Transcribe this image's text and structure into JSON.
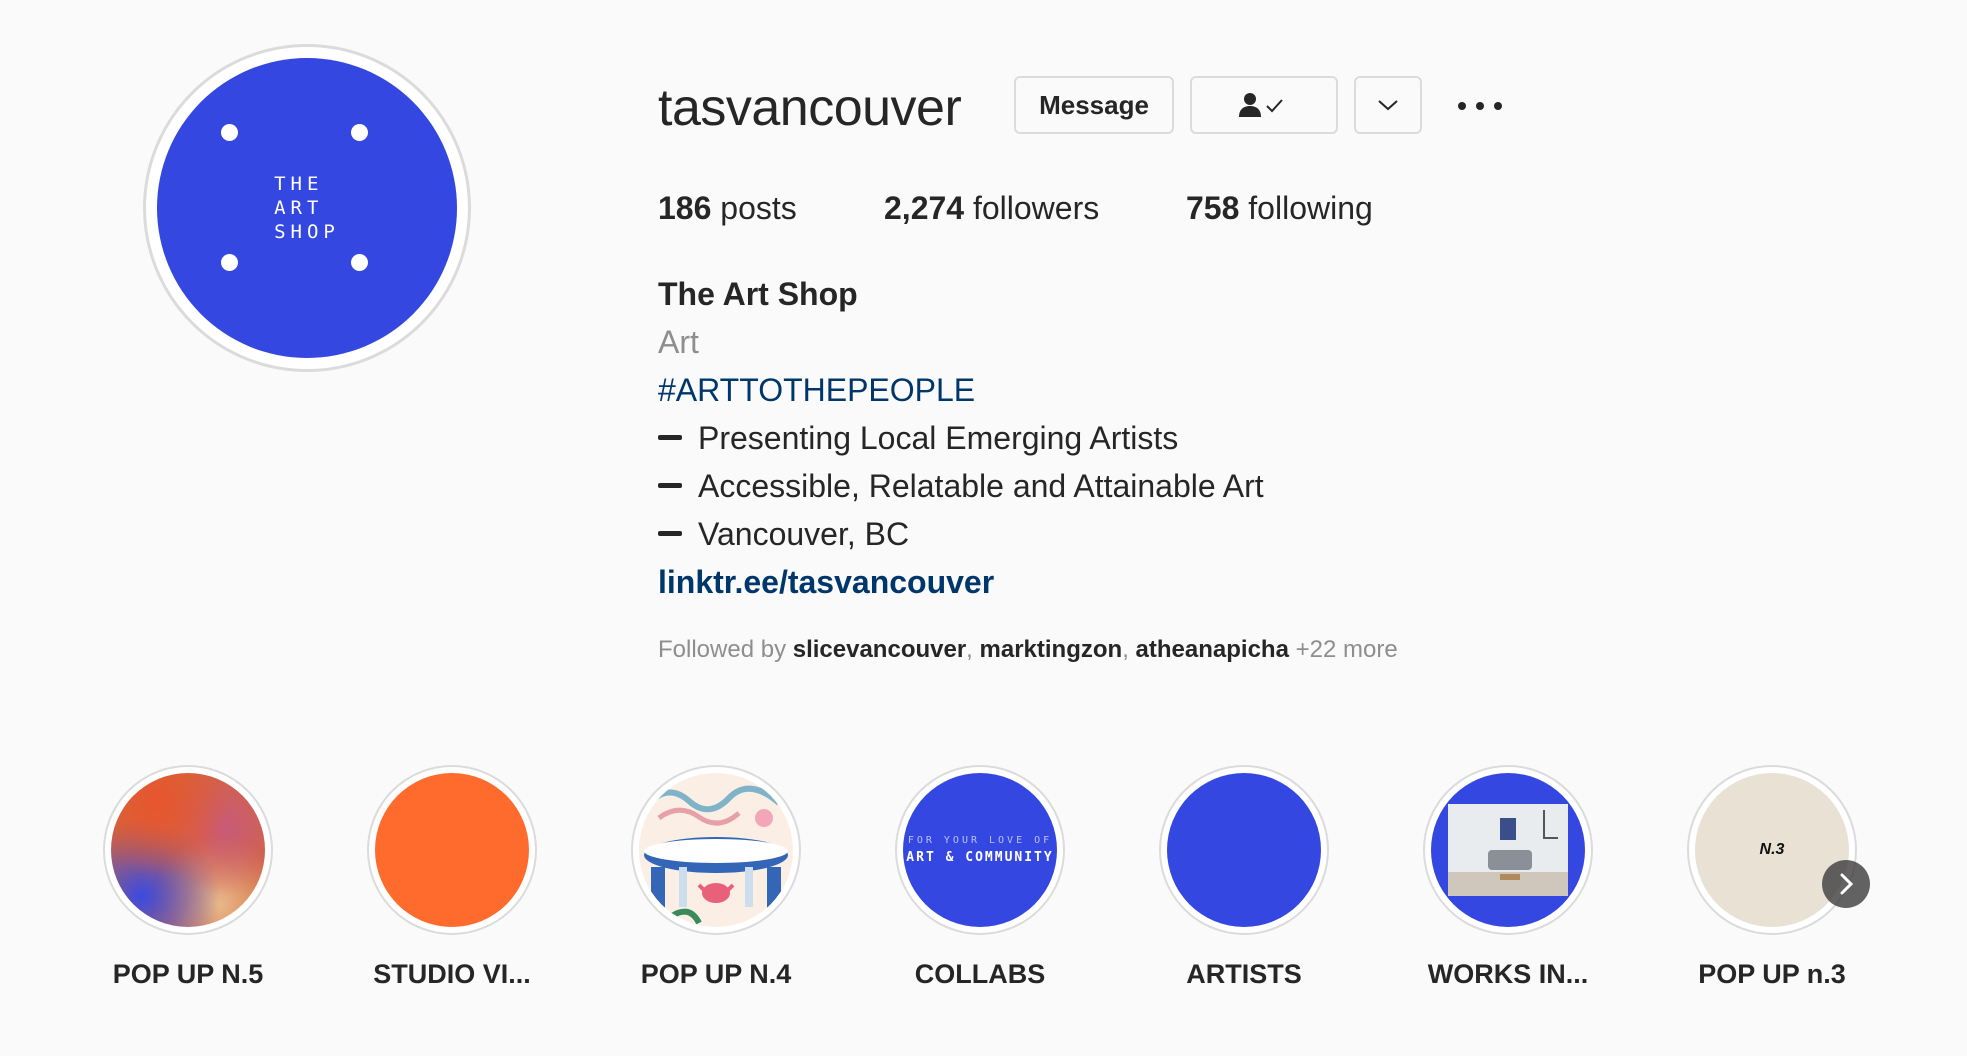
{
  "profile": {
    "username": "tasvancouver",
    "avatar_text": [
      "THE",
      "ART",
      "SHOP"
    ],
    "avatar_color": "#3447e1"
  },
  "actions": {
    "message_label": "Message",
    "following_icon": "person-check-icon",
    "dropdown_icon": "chevron-down-icon",
    "more_icon": "more-options-icon"
  },
  "stats": {
    "posts_count": "186",
    "posts_label": "posts",
    "followers_count": "2,274",
    "followers_label": "followers",
    "following_count": "758",
    "following_label": "following"
  },
  "bio": {
    "name": "The Art Shop",
    "category": "Art",
    "hashtag": "#ARTTOTHEPEOPLE",
    "lines": [
      "Presenting Local Emerging Artists",
      "Accessible, Relatable and Attainable Art",
      "Vancouver, BC"
    ],
    "link": "linktr.ee/tasvancouver"
  },
  "followed_by": {
    "prefix": "Followed by",
    "users": [
      "slicevancouver",
      "marktingzon",
      "atheanapicha"
    ],
    "more": "+22 more"
  },
  "highlights": [
    {
      "label": "POP UP N.5"
    },
    {
      "label": "STUDIO VI..."
    },
    {
      "label": "POP UP N.4"
    },
    {
      "label": "COLLABS",
      "caption_top": "FOR YOUR LOVE OF",
      "caption_bottom": "ART & COMMUNITY"
    },
    {
      "label": "ARTISTS"
    },
    {
      "label": "WORKS IN..."
    },
    {
      "label": "POP UP n.3",
      "caption": "N.3"
    }
  ],
  "colors": {
    "brand_blue": "#3447e1",
    "orange": "#ff6b2c",
    "link_blue": "#00376b",
    "beige": "#e8e1d4"
  }
}
